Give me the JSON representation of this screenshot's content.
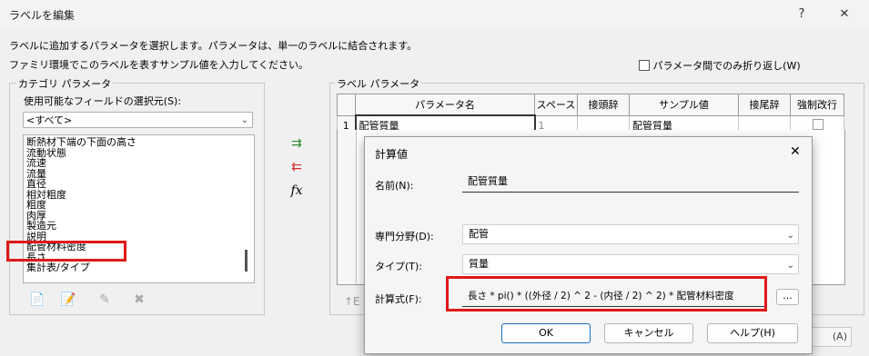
{
  "window": {
    "title": "ラベルを編集",
    "help": "?",
    "close": "✕"
  },
  "description": {
    "line1": "ラベルに追加するパラメータを選択します。パラメータは、単一のラベルに結合されます。",
    "line2": "ファミリ環境でこのラベルを表すサンプル値を入力してください。"
  },
  "wrap_checkbox": {
    "label": "パラメータ間でのみ折り返し(W)",
    "checked": false
  },
  "category": {
    "legend": "カテゴリ パラメータ",
    "select_label": "使用可能なフィールドの選択元(S):",
    "select_value": "<すべて>",
    "items": [
      "断熱材下端の下面の高さ",
      "流動状態",
      "流速",
      "流量",
      "直径",
      "相対粗度",
      "粗度",
      "肉厚",
      "製造元",
      "説明",
      "配管材料密度",
      "長さ",
      "集計表/タイプ"
    ],
    "selected_index": 10
  },
  "label_params": {
    "legend": "ラベル パラメータ",
    "columns": [
      "パラメータ名",
      "スペース",
      "接頭辞",
      "サンプル値",
      "接尾辞",
      "強制改行"
    ],
    "rows": [
      {
        "num": "1",
        "name": "配管質量",
        "space": "1",
        "prefix": "",
        "sample": "配管質量",
        "suffix": "",
        "break": false
      }
    ]
  },
  "bottom_left_fragment": "↑E",
  "bottom_right_fragment": "(A)",
  "calc_dialog": {
    "title": "計算値",
    "close": "✕",
    "name_label": "名前(N):",
    "name_value": "配管質量",
    "discipline_label": "専門分野(D):",
    "discipline_value": "配管",
    "type_label": "タイプ(T):",
    "type_value": "質量",
    "formula_label": "計算式(F):",
    "formula_value": "長さ * pi() * ((外径 / 2) ^ 2 - (内径 / 2) ^ 2) * 配管材料密度",
    "browse": "...",
    "ok": "OK",
    "cancel": "キャンセル",
    "help": "ヘルプ(H)"
  },
  "colors": {
    "highlight_red": "#e01818",
    "accent_blue": "#1a6fc4"
  }
}
